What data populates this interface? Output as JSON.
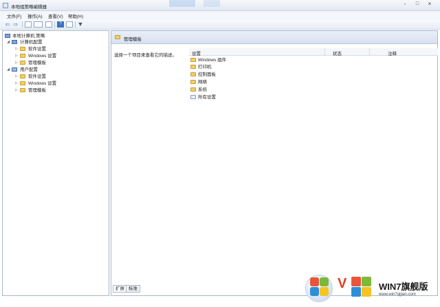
{
  "window": {
    "title": "本地组策略编辑器",
    "controls": [
      "-",
      "□",
      "×"
    ]
  },
  "menu": [
    "文件(F)",
    "操作(A)",
    "查看(V)",
    "帮助(H)"
  ],
  "toolbar": {
    "back_icon": "back-arrow-icon",
    "forward_icon": "forward-arrow-icon",
    "help_label": "?"
  },
  "tree": {
    "root": "本地计算机 策略",
    "computer": "计算机配置",
    "user": "用户配置",
    "computer_children": [
      "软件设置",
      "Windows 设置",
      "管理模板"
    ],
    "user_children": [
      "软件设置",
      "Windows 设置",
      "管理模板"
    ]
  },
  "right": {
    "header": "管理模板",
    "description": "选择一个项目来查看它的描述。",
    "columns": [
      "设置",
      "状态",
      "注释"
    ],
    "items": [
      "Windows 组件",
      "打印机",
      "控制面板",
      "网络",
      "系统",
      "所有设置"
    ]
  },
  "tabs": [
    "扩展",
    "标准"
  ],
  "watermark": {
    "brand": "WIN7旗舰版",
    "url": "www.win7qijian.com"
  }
}
